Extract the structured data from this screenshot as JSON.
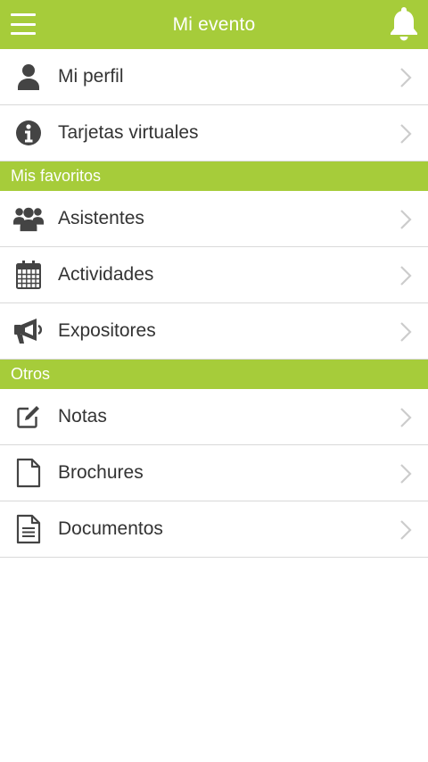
{
  "header": {
    "title": "Mi evento",
    "bg_color": "#a6cc3a",
    "menu_icon": "menu-icon",
    "bell_icon": "bell-icon"
  },
  "top_items": [
    {
      "label": "Mi perfil",
      "icon": "user-icon"
    },
    {
      "label": "Tarjetas virtuales",
      "icon": "info-icon"
    }
  ],
  "favoritos": {
    "title": "Mis favoritos",
    "items": [
      {
        "label": "Asistentes",
        "icon": "users-icon"
      },
      {
        "label": "Actividades",
        "icon": "calendar-icon"
      },
      {
        "label": "Expositores",
        "icon": "megaphone-icon"
      }
    ]
  },
  "otros": {
    "title": "Otros",
    "items": [
      {
        "label": "Notas",
        "icon": "edit-icon"
      },
      {
        "label": "Brochures",
        "icon": "file-icon"
      },
      {
        "label": "Documentos",
        "icon": "document-icon"
      }
    ]
  },
  "colors": {
    "accent": "#a6cc3a",
    "icon": "#444444",
    "chevron": "#cccccc",
    "divider": "#d9d9d9"
  }
}
